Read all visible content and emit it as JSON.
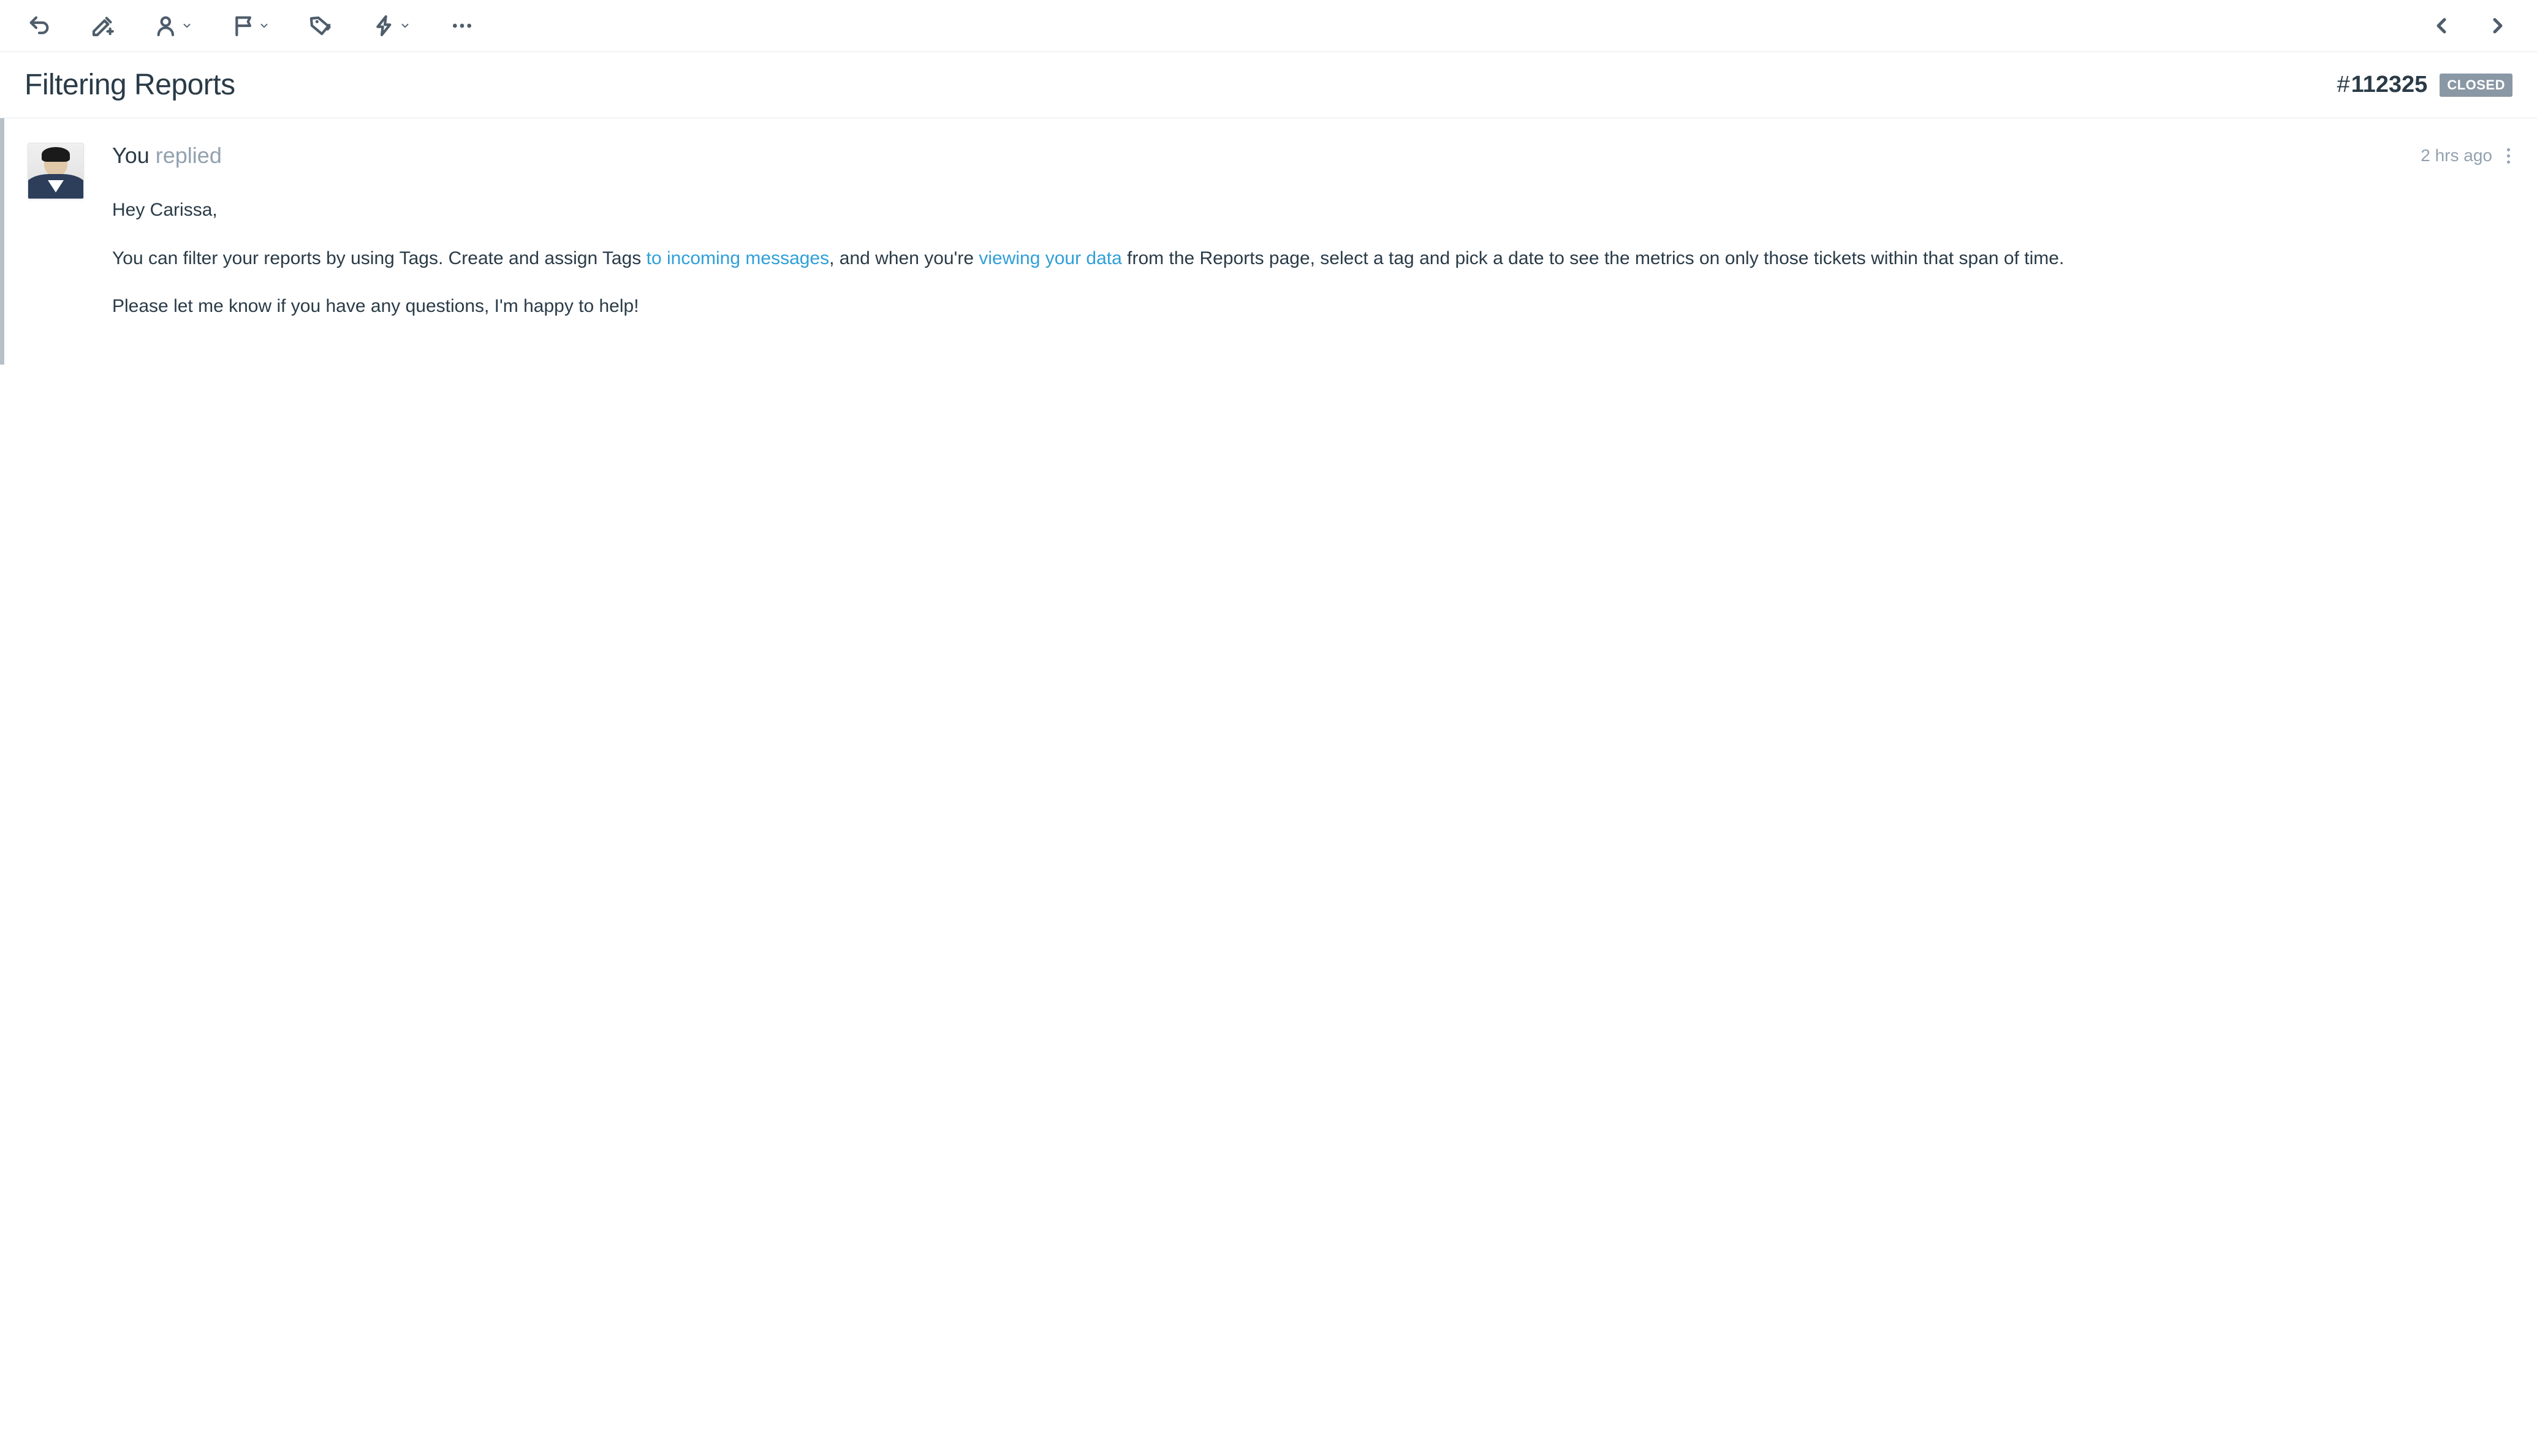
{
  "header": {
    "title": "Filtering Reports",
    "ticket_hash": "#",
    "ticket_number": "112325",
    "status": "CLOSED"
  },
  "message": {
    "author": "You",
    "action": "replied",
    "timestamp": "2 hrs ago",
    "greeting": "Hey Carissa,",
    "body_part1": "You can filter your reports by using Tags. Create and assign Tags ",
    "link1": "to incoming messages",
    "body_part2": ", and when you're ",
    "link2": "viewing your data",
    "body_part3": " from the Reports page, select a tag and pick a date to see the metrics on only those tickets within that span of time.",
    "closing": "Please let me know if you have any questions, I'm happy to help!"
  }
}
